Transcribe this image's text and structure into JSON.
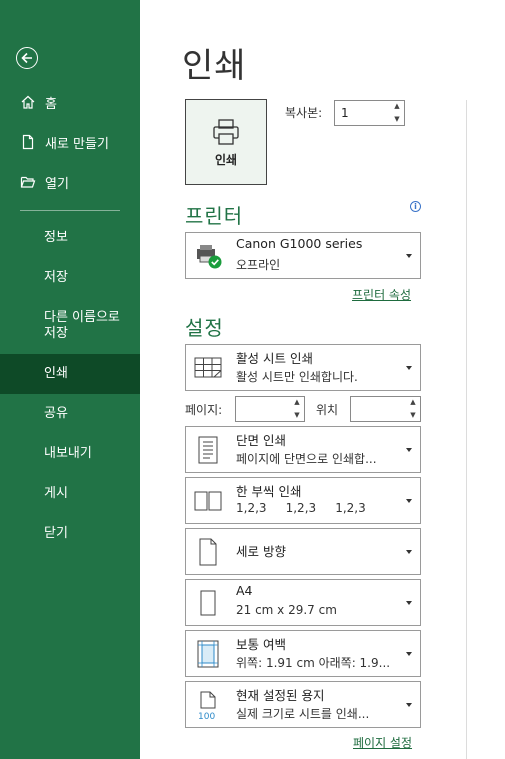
{
  "sidebar": {
    "back_icon": "arrow-left-circle-icon",
    "items_top": [
      {
        "label": "홈",
        "icon": "home-icon"
      },
      {
        "label": "새로 만들기",
        "icon": "new-document-icon"
      },
      {
        "label": "열기",
        "icon": "open-folder-icon"
      }
    ],
    "items_text": [
      "정보",
      "저장",
      "다른 이름으로 저장",
      "인쇄",
      "공유",
      "내보내기",
      "게시",
      "닫기"
    ],
    "active": "인쇄"
  },
  "main": {
    "title": "인쇄",
    "print_button_label": "인쇄",
    "copies_label": "복사본:",
    "copies_value": "1",
    "printer_section_title": "프린터",
    "printer": {
      "name": "Canon G1000 series",
      "status": "오프라인"
    },
    "printer_properties_link": "프린터 속성",
    "settings_section_title": "설정",
    "settings": [
      {
        "title": "활성 시트 인쇄",
        "subtitle": "활성 시트만 인쇄합니다.",
        "icon": "sheet-grid-icon"
      },
      {
        "title": "단면 인쇄",
        "subtitle": "페이지에 단면으로 인쇄합...",
        "icon": "single-sided-icon"
      },
      {
        "title": "한 부씩 인쇄",
        "subtitle": "1,2,3     1,2,3     1,2,3",
        "icon": "collate-icon"
      },
      {
        "title": "세로 방향",
        "subtitle": "",
        "icon": "portrait-icon"
      },
      {
        "title": "A4",
        "subtitle": "21 cm x 29.7 cm",
        "icon": "paper-size-icon"
      },
      {
        "title": "보통 여백",
        "subtitle": "위쪽: 1.91 cm 아래쪽: 1.9...",
        "icon": "margins-icon"
      },
      {
        "title": "현재 설정된 용지",
        "subtitle": "실제 크기로 시트를 인쇄...",
        "icon": "scaling-100-icon",
        "icon_text": "100"
      }
    ],
    "pages_label": "페이지:",
    "pages_from": "",
    "pages_to_label": "위치",
    "pages_to": "",
    "page_setup_link": "페이지 설정"
  },
  "colors": {
    "accent": "#217346",
    "active_nav": "#0e4a27",
    "status_ok": "#1a9c3c"
  }
}
